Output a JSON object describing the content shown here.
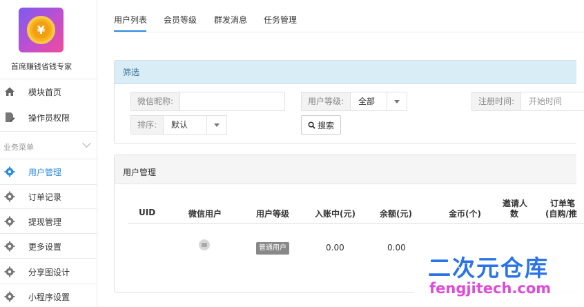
{
  "app": {
    "name": "首席赚钱省钱专家",
    "logo_glyph": "¥"
  },
  "sidebar": {
    "top_items": [
      {
        "label": "模块首页",
        "icon": "home-icon"
      },
      {
        "label": "操作员权限",
        "icon": "doc-edit-icon"
      }
    ],
    "section_title": "业务菜单",
    "items": [
      {
        "label": "用户管理",
        "icon": "gear-icon",
        "active": true
      },
      {
        "label": "订单记录",
        "icon": "gear-icon"
      },
      {
        "label": "提现管理",
        "icon": "gear-icon"
      },
      {
        "label": "更多设置",
        "icon": "gear-icon"
      },
      {
        "label": "分享图设计",
        "icon": "gear-icon"
      },
      {
        "label": "小程序设置",
        "icon": "gear-icon"
      }
    ]
  },
  "tabs": [
    {
      "label": "用户列表",
      "active": true
    },
    {
      "label": "会员等级"
    },
    {
      "label": "群发消息"
    },
    {
      "label": "任务管理"
    }
  ],
  "filter": {
    "title": "筛选",
    "nickname_label": "微信昵称:",
    "nickname_value": "",
    "level_label": "用户等级:",
    "level_value": "全部",
    "regtime_label": "注册时间:",
    "regtime_placeholder": "开始时间",
    "sort_label": "排序:",
    "sort_value": "默认",
    "search_button": "搜索"
  },
  "table": {
    "title": "用户管理",
    "columns": [
      "UID",
      "微信用户",
      "用户等级",
      "入账中(元)",
      "余额(元)",
      "金币(个)",
      "邀请人",
      "数",
      "订单笔",
      "(自购/推"
    ],
    "rows": [
      {
        "uid": "",
        "level": "普通用户",
        "pending": "0.00",
        "balance": "0.00"
      }
    ]
  },
  "watermark": {
    "line1": "二次元仓库",
    "line2": "fengjitech.com"
  },
  "colors": {
    "accent": "#2b8be0",
    "filter_header_bg": "#d9edf7",
    "badge": "#888888"
  }
}
